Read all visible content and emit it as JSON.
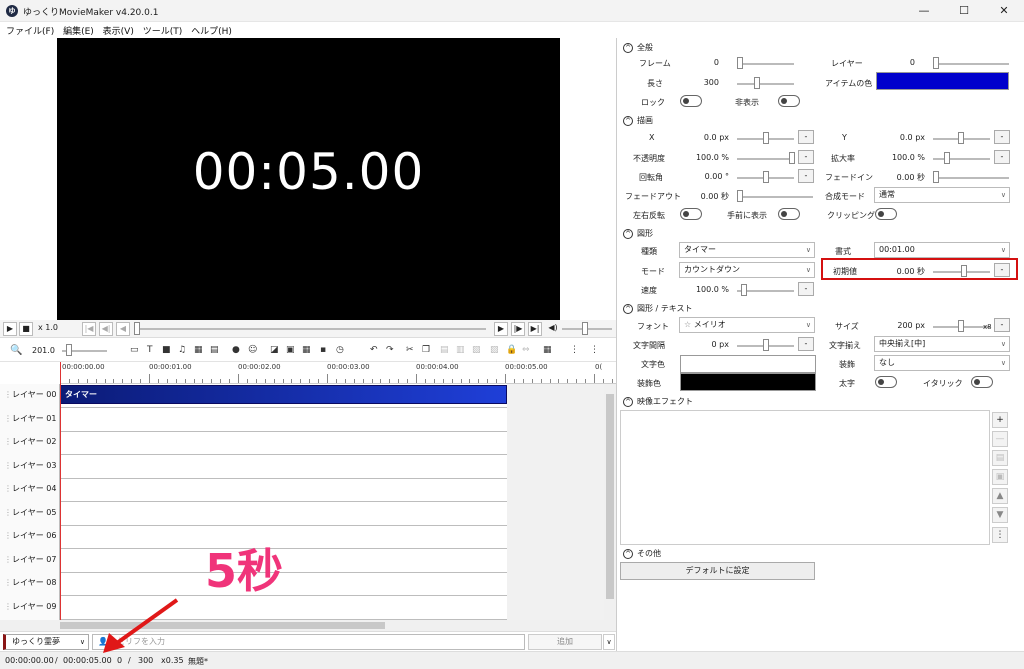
{
  "window": {
    "title": "ゆっくりMovieMaker v4.20.0.1",
    "minimize": "—",
    "maximize": "☐",
    "close": "✕"
  },
  "menu": [
    "ファイル(F)",
    "編集(E)",
    "表示(V)",
    "ツール(T)",
    "ヘルプ(H)"
  ],
  "preview": {
    "time": "00:05.00"
  },
  "playback": {
    "speed": "x 1.0"
  },
  "timeline": {
    "zoom": "201.0",
    "ruler": [
      "00:00:00.00",
      "00:00:01.00",
      "00:00:02.00",
      "00:00:03.00",
      "00:00:04.00",
      "00:00:05.00",
      "0("
    ],
    "layers": [
      "レイヤー 00",
      "レイヤー 01",
      "レイヤー 02",
      "レイヤー 03",
      "レイヤー 04",
      "レイヤー 05",
      "レイヤー 06",
      "レイヤー 07",
      "レイヤー 08",
      "レイヤー 09"
    ],
    "clip_label": "タイマー"
  },
  "bottom": {
    "character": "ゆっくり霊夢",
    "serif_placeholder": "セリフを入力",
    "add": "追加"
  },
  "status": {
    "current": "00:00:00.00",
    "sep": "/",
    "total": "00:00:05.00",
    "frame": "0",
    "frame_sep": "/",
    "frames": "300",
    "zoom": "x0.35",
    "project": "無題*"
  },
  "annotation": {
    "text": "5秒",
    "color": "#f0347a"
  },
  "panel": {
    "general": {
      "header": "全般",
      "frame_label": "フレーム",
      "frame_val": "0",
      "layer_label": "レイヤー",
      "layer_val": "0",
      "length_label": "長さ",
      "length_val": "300",
      "item_color_label": "アイテムの色",
      "item_color": "#0000cc",
      "lock_label": "ロック",
      "hide_label": "非表示"
    },
    "draw": {
      "header": "描画",
      "x_label": "X",
      "x_val": "0.0 px",
      "y_label": "Y",
      "y_val": "0.0 px",
      "opacity_label": "不透明度",
      "opacity_val": "100.0 %",
      "scale_label": "拡大率",
      "scale_val": "100.0 %",
      "rotation_label": "回転角",
      "rotation_val": "0.00 °",
      "fadein_label": "フェードイン",
      "fadein_val": "0.00 秒",
      "fadeout_label": "フェードアウト",
      "fadeout_val": "0.00 秒",
      "blend_label": "合成モード",
      "blend_val": "通常",
      "flip_label": "左右反転",
      "front_label": "手前に表示",
      "clip_label": "クリッピング"
    },
    "shape": {
      "header": "図形",
      "type_label": "種類",
      "type_val": "タイマー",
      "format_label": "書式",
      "format_val": "00:01.00",
      "mode_label": "モード",
      "mode_val": "カウントダウン",
      "initial_label": "初期値",
      "initial_val": "0.00 秒",
      "speed_label": "速度",
      "speed_val": "100.0 %"
    },
    "text": {
      "header": "図形 / テキスト",
      "font_label": "フォント",
      "font_val": "メイリオ",
      "size_label": "サイズ",
      "size_val": "200 px",
      "size_extra": "x8",
      "spacing_label": "文字間隔",
      "spacing_val": "0 px",
      "align_label": "文字揃え",
      "align_val": "中央揃え[中]",
      "color_label": "文字色",
      "color_val": "#ffffff",
      "deco_label": "装飾",
      "deco_val": "なし",
      "decocolor_label": "装飾色",
      "decocolor_val": "#000000",
      "bold_label": "太字",
      "italic_label": "イタリック"
    },
    "effects": {
      "header": "映像エフェクト"
    },
    "other": {
      "header": "その他",
      "default_btn": "デフォルトに設定"
    }
  }
}
